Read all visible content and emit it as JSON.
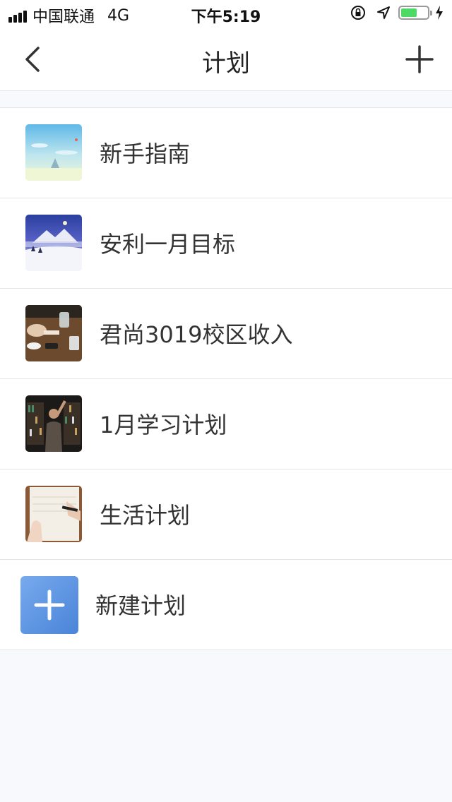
{
  "status_bar": {
    "carrier": "中国联通",
    "network": "4G",
    "time": "下午5:19"
  },
  "nav": {
    "title": "计划"
  },
  "plans": [
    {
      "label": "新手指南",
      "thumb": "sky-landscape-image"
    },
    {
      "label": "安利一月目标",
      "thumb": "snowy-mountain-night-image"
    },
    {
      "label": "君尚3019校区收入",
      "thumb": "desk-coffee-image"
    },
    {
      "label": "1月学习计划",
      "thumb": "library-person-image"
    },
    {
      "label": "生活计划",
      "thumb": "notebook-writing-image"
    }
  ],
  "new_plan": {
    "label": "新建计划"
  },
  "colors": {
    "accent_tile": "#4a84d8",
    "battery": "#4cd964",
    "background": "#f7f9fc"
  }
}
